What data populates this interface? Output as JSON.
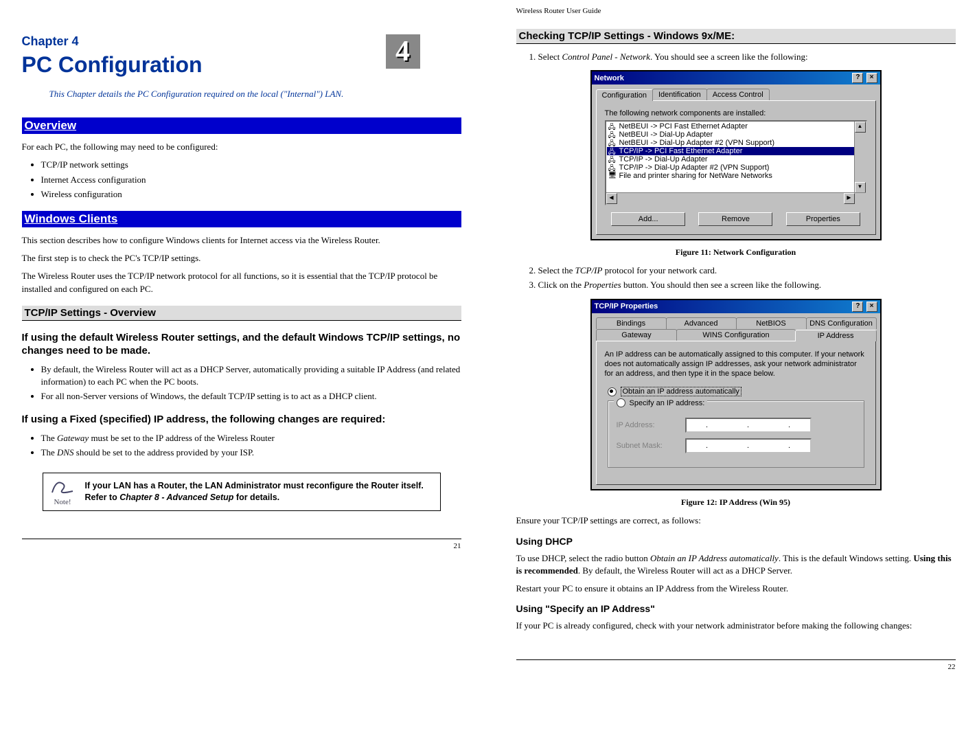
{
  "doc_header": "Wireless Router User Guide",
  "left": {
    "chapter_label": "Chapter 4",
    "chapter_title": "PC Configuration",
    "chapter_number": "4",
    "intro": "This Chapter details the PC Configuration required on the local (\"Internal\") LAN.",
    "sec_overview": "Overview",
    "overview_p": "For each PC, the following may need to be configured:",
    "overview_items": [
      "TCP/IP network settings",
      "Internet Access configuration",
      "Wireless configuration"
    ],
    "sec_windows": "Windows Clients",
    "win_p1": "This section describes how to configure Windows clients for Internet access via the Wireless Router.",
    "win_p2": "The first step is to check the PC's TCP/IP settings.",
    "win_p3": "The Wireless Router uses the TCP/IP network protocol for all functions, so it is essential that the TCP/IP protocol be installed and configured on each PC.",
    "sub_tcpip": "TCP/IP Settings - Overview",
    "bold_p1": "If using the default Wireless Router settings, and the default Windows TCP/IP settings, no changes need to be made.",
    "bullets1": [
      "By default, the Wireless Router will act as a DHCP Server, automatically providing a suitable IP Address (and related information) to each PC when the PC boots.",
      "For all non-Server versions of Windows, the default TCP/IP setting is to act as a DHCP client."
    ],
    "bold_p2": "If using a Fixed (specified) IP address, the following changes are required:",
    "bullets2_a_pre": "The ",
    "bullets2_a_it": "Gateway",
    "bullets2_a_post": " must be set to the IP address of the Wireless Router",
    "bullets2_b_pre": "The ",
    "bullets2_b_it": "DNS",
    "bullets2_b_post": " should be set to the address provided by your ISP.",
    "note_label": "Note!",
    "note_text_1": "If your LAN has a Router, the LAN Administrator must reconfigure the Router itself. Refer to ",
    "note_text_chapter": "Chapter 8 - Advanced Setup",
    "note_text_2": " for details.",
    "page_number": "21"
  },
  "right": {
    "heading": "Checking TCP/IP Settings - Windows 9x/ME:",
    "step1_pre": "Select ",
    "step1_it": "Control Panel - Network",
    "step1_post": ". You should see a screen like the following:",
    "dialog1": {
      "title": "Network",
      "tabs": [
        "Configuration",
        "Identification",
        "Access Control"
      ],
      "list_label": "The following network components are installed:",
      "items": [
        "NetBEUI -> PCI Fast Ethernet Adapter",
        "NetBEUI -> Dial-Up Adapter",
        "NetBEUI -> Dial-Up Adapter #2 (VPN Support)",
        "TCP/IP -> PCI Fast Ethernet Adapter",
        "TCP/IP -> Dial-Up Adapter",
        "TCP/IP -> Dial-Up Adapter #2 (VPN Support)",
        "File and printer sharing for NetWare Networks"
      ],
      "selected_index": 3,
      "buttons": [
        "Add...",
        "Remove",
        "Properties"
      ]
    },
    "fig11": "Figure 11: Network Configuration",
    "step2_pre": "Select the ",
    "step2_it": "TCP/IP",
    "step2_post": " protocol for your network card.",
    "step3_pre": "Click on the ",
    "step3_it": "Properties",
    "step3_post": " button. You should then see a screen like the following.",
    "dialog2": {
      "title": "TCP/IP Properties",
      "tabs_row1": [
        "Bindings",
        "Advanced",
        "NetBIOS",
        "DNS Configuration"
      ],
      "tabs_row2": [
        "Gateway",
        "WINS Configuration",
        "IP Address"
      ],
      "intro": "An IP address can be automatically assigned to this computer. If your network does not automatically assign IP addresses, ask your network administrator for an address, and then type it in the space below.",
      "radio1": "Obtain an IP address automatically",
      "radio2": "Specify an IP address:",
      "field_ip": "IP Address:",
      "field_mask": "Subnet Mask:"
    },
    "fig12": "Figure 12: IP Address (Win 95)",
    "ensure": "Ensure your TCP/IP settings are correct, as follows:",
    "sub_dhcp": "Using DHCP",
    "dhcp_p_pre": "To use DHCP, select the radio button ",
    "dhcp_p_it": "Obtain an IP Address automatically",
    "dhcp_p_mid": ". This is the default Windows setting. ",
    "dhcp_p_bold": "Using this is recommended",
    "dhcp_p_post": ". By default, the Wireless Router will act as a DHCP Server.",
    "dhcp_p2": "Restart your PC to ensure it obtains an IP Address from the Wireless Router.",
    "sub_specify": "Using \"Specify an IP Address\"",
    "specify_p": "If your PC is already configured, check with your network administrator before making the following changes:",
    "page_number": "22"
  }
}
